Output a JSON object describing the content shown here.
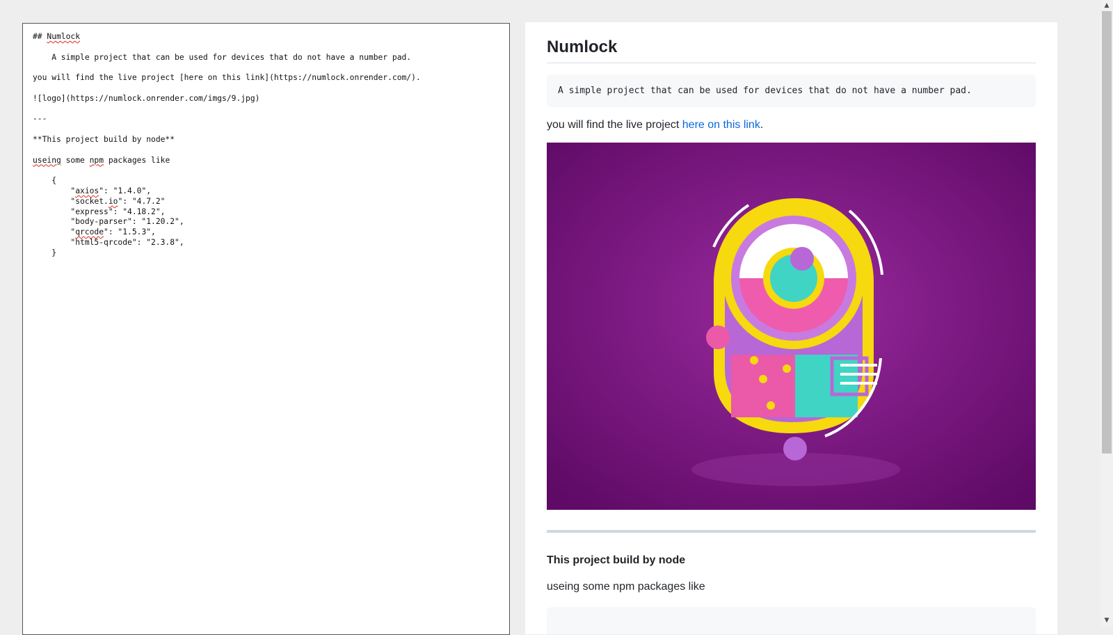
{
  "editor": {
    "lines": {
      "l1_prefix": "## ",
      "l1_word": "Numlock",
      "l2": "    A simple project that can be used for devices that do not have a number pad.",
      "l3": "you will find the live project [here on this link](https://numlock.onrender.com/).",
      "l4": "![logo](https://numlock.onrender.com/imgs/9.jpg)",
      "l5": "---",
      "l6": "**This project build by node**",
      "l7_word1": "useing",
      "l7_mid": " some ",
      "l7_word2": "npm",
      "l7_rest": " packages like",
      "c_open": "    {",
      "c1_pre": "        \"",
      "c1_word": "axios",
      "c1_post": "\": \"1.4.0\",",
      "c2_pre": "        \"socket.",
      "c2_word": "io",
      "c2_post": "\": \"4.7.2\"",
      "c3": "        \"express\": \"4.18.2\",",
      "c4": "        \"body-parser\": \"1.20.2\",",
      "c5_pre": "        \"",
      "c5_word": "qrcode",
      "c5_post": "\": \"1.5.3\",",
      "c6": "        \"html5-qrcode\": \"2.3.8\",",
      "c_close": "    }"
    }
  },
  "preview": {
    "heading": "Numlock",
    "code": "A simple project that can be used for devices that do not have a number pad.",
    "para_before_link": "you will find the live project ",
    "link_text": "here on this link",
    "para_after_link": ".",
    "bold_text": "This project build by node",
    "para2": "useing some npm packages like"
  },
  "scrollbar": {
    "up_arrow": "▲",
    "down_arrow": "▼"
  },
  "colors": {
    "link": "#0969da",
    "image_bg": "#7a1081",
    "accent_yellow": "#f6d90e",
    "accent_pink": "#ea5aa8",
    "accent_lilac": "#c77be0",
    "accent_teal": "#40d4c4"
  }
}
